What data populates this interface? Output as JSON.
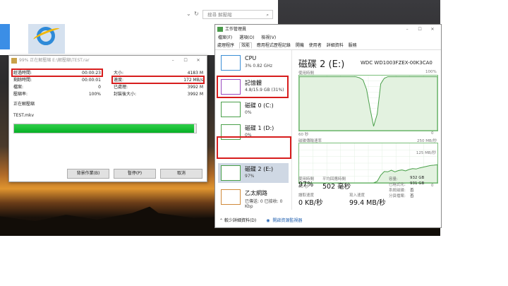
{
  "explorer": {
    "search_placeholder": "搜尋 解壓縮",
    "search_icon": "magnifier",
    "back": "‹",
    "refresh": "↻"
  },
  "copy_dialog": {
    "title": "99% 正在解壓縮 E:\\解壓縮\\TEST.rar",
    "rows": [
      {
        "label": "經過時間:",
        "value": "00:00:23",
        "label2": "大小:",
        "value2": "4183 M"
      },
      {
        "label": "剩餘時間:",
        "value": "00:00:01",
        "label2": "速度:",
        "value2": "172 MB/s"
      },
      {
        "label": "檔案:",
        "value": "0",
        "label2": "已處理:",
        "value2": "3992 M"
      },
      {
        "label": "壓縮率:",
        "value": "100%",
        "label2": "封裝後大小:",
        "value2": "3992 M"
      }
    ],
    "status": "正在解壓縮",
    "filename": "TEST.mkv",
    "progress_fraction": 0.99,
    "buttons": {
      "background": "背景作業(B)",
      "pause": "暫停(P)",
      "cancel": "取消"
    }
  },
  "task_manager": {
    "title": "工作管理員",
    "menu": [
      "檔案(F)",
      "選項(O)",
      "檢視(V)"
    ],
    "tabs": [
      "處理程序",
      "效能",
      "應用程式歷程記錄",
      "開機",
      "使用者",
      "詳細資料",
      "服務"
    ],
    "active_tab": "效能",
    "sidebar": [
      {
        "name": "CPU",
        "sub": "3% 0.82 GHz"
      },
      {
        "name": "記憶體",
        "sub": "4.8/15.9 GB (31%)"
      },
      {
        "name": "磁碟 0 (C:)",
        "sub": "0%"
      },
      {
        "name": "磁碟 1 (D:)",
        "sub": "0%"
      },
      {
        "name": "磁碟 2 (E:)",
        "sub": "97%"
      },
      {
        "name": "乙太網路",
        "sub": "已傳送: 0 已接收: 0 Kbp"
      }
    ],
    "disk_title": "磁碟 2 (E:)",
    "disk_model": "WDC WD1003FZEX-00K3CA0",
    "chart1_label": "使用時間",
    "chart1_max": "100%",
    "chart1_time": "60 秒",
    "chart1_min": "0",
    "chart2_label": "磁碟傳輸速率",
    "chart2_max": "250 MB/秒",
    "chart2_mid": "125 MB/秒",
    "chart2_time": "60 秒",
    "chart2_min": "0",
    "stats": {
      "active_label": "使用時間",
      "active_value": "97%",
      "response_label": "平均回應時間",
      "response_value": "502 毫秒",
      "read_label": "讀取速度",
      "read_value": "0 KB/秒",
      "write_label": "寫入速度",
      "write_value": "99.4 MB/秒"
    },
    "info": [
      {
        "k": "容量:",
        "v": "932 GB"
      },
      {
        "k": "已格式化:",
        "v": "931 GB"
      },
      {
        "k": "系統磁碟:",
        "v": "否"
      },
      {
        "k": "分頁檔案:",
        "v": "否"
      }
    ],
    "footer": {
      "less": "較少詳細資料(D)",
      "open_monitor": "開啟資源監視器"
    },
    "usage_series": [
      98,
      98,
      98,
      98,
      98,
      98,
      98,
      98,
      98,
      98,
      98,
      98,
      98,
      98,
      98,
      98,
      98,
      96,
      92,
      75,
      40,
      8,
      30,
      85,
      95,
      98,
      98,
      98,
      98,
      98,
      98,
      98,
      98,
      98,
      98,
      98,
      98,
      98,
      98,
      98
    ],
    "rate_series": [
      0,
      0,
      0,
      0,
      0,
      0,
      0,
      0,
      0,
      0,
      0,
      0,
      0,
      0,
      0,
      0,
      0,
      0,
      0,
      0,
      0,
      0,
      10,
      48,
      72,
      70,
      80,
      70,
      78,
      82,
      76,
      85,
      90,
      88,
      95,
      100,
      105,
      110,
      112,
      115
    ]
  }
}
